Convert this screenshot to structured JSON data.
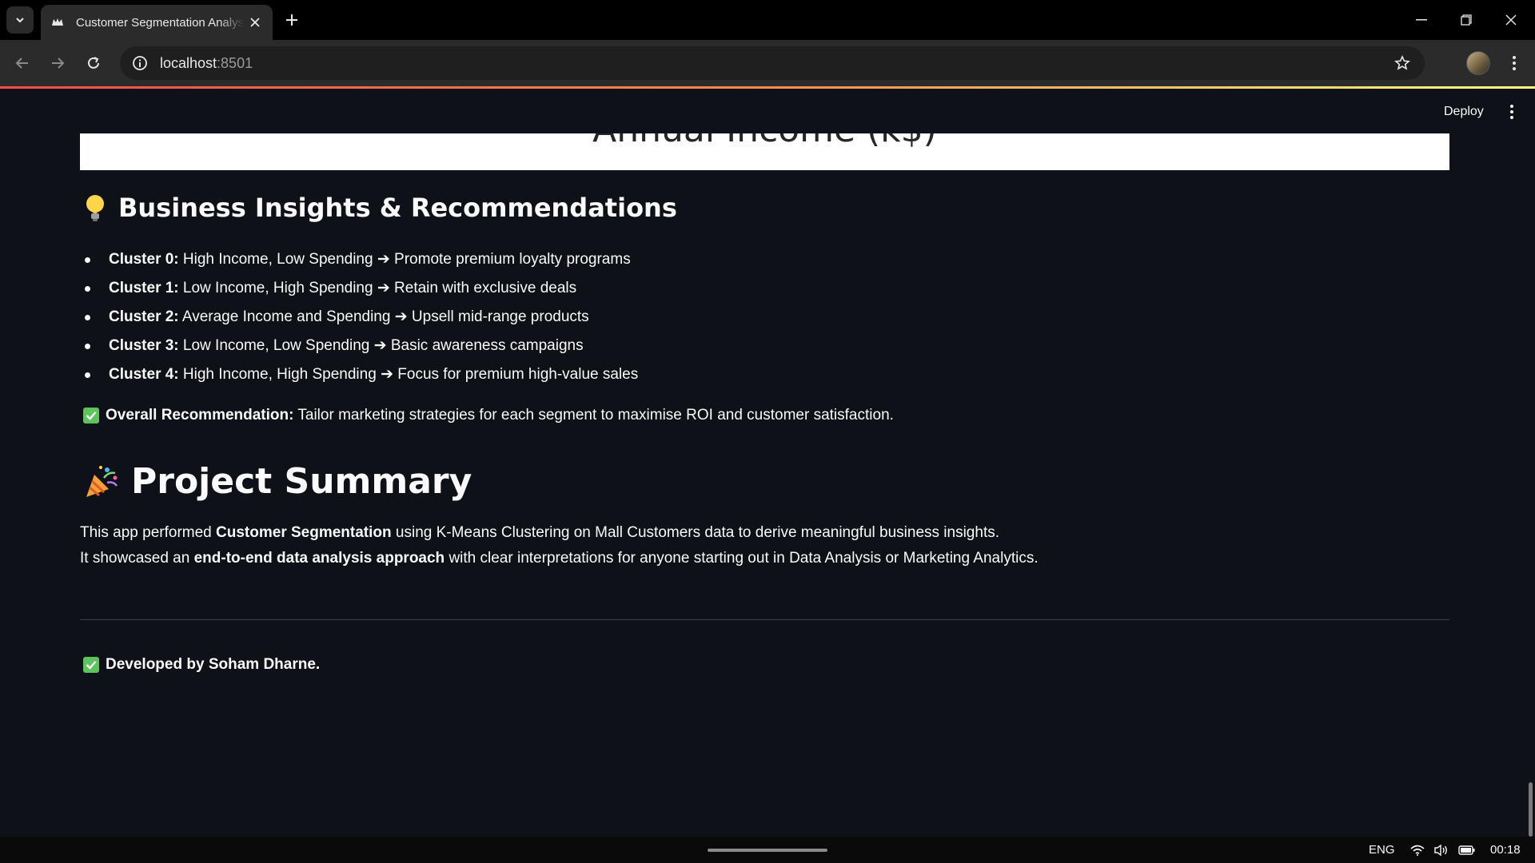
{
  "browser": {
    "tab_title": "Customer Segmentation Analysis",
    "url_host": "localhost",
    "url_port": ":8501"
  },
  "app": {
    "deploy_label": "Deploy",
    "chart_tail_label": "Annual Income (k$)"
  },
  "insights": {
    "emoji": "light-bulb-icon",
    "title": "Business Insights & Recommendations",
    "items": [
      {
        "cluster": "Cluster 0:",
        "text": " High Income, Low Spending ➔ Promote premium loyalty programs"
      },
      {
        "cluster": "Cluster 1:",
        "text": " Low Income, High Spending ➔ Retain with exclusive deals"
      },
      {
        "cluster": "Cluster 2:",
        "text": " Average Income and Spending ➔ Upsell mid-range products"
      },
      {
        "cluster": "Cluster 3:",
        "text": " Low Income, Low Spending ➔ Basic awareness campaigns"
      },
      {
        "cluster": "Cluster 4:",
        "text": " High Income, High Spending ➔ Focus for premium high-value sales"
      }
    ],
    "recommendation_label": "Overall Recommendation:",
    "recommendation_text": " Tailor marketing strategies for each segment to maximise ROI and customer satisfaction."
  },
  "summary": {
    "emoji": "party-popper-icon",
    "title": "Project Summary",
    "line1_pre": "This app performed ",
    "line1_bold": "Customer Segmentation",
    "line1_post": " using K-Means Clustering on Mall Customers data to derive meaningful business insights.",
    "line2_pre": "It showcased an ",
    "line2_bold": "end-to-end data analysis approach",
    "line2_post": " with clear interpretations for anyone starting out in Data Analysis or Marketing Analytics."
  },
  "footer": {
    "developed_by": "Developed by Soham Dharne."
  },
  "taskbar": {
    "language": "ENG",
    "time": "00:18"
  },
  "colors": {
    "app_bg": "#0e1117",
    "check_green": "#5ec25e",
    "accent_red": "#ff4b4b"
  }
}
